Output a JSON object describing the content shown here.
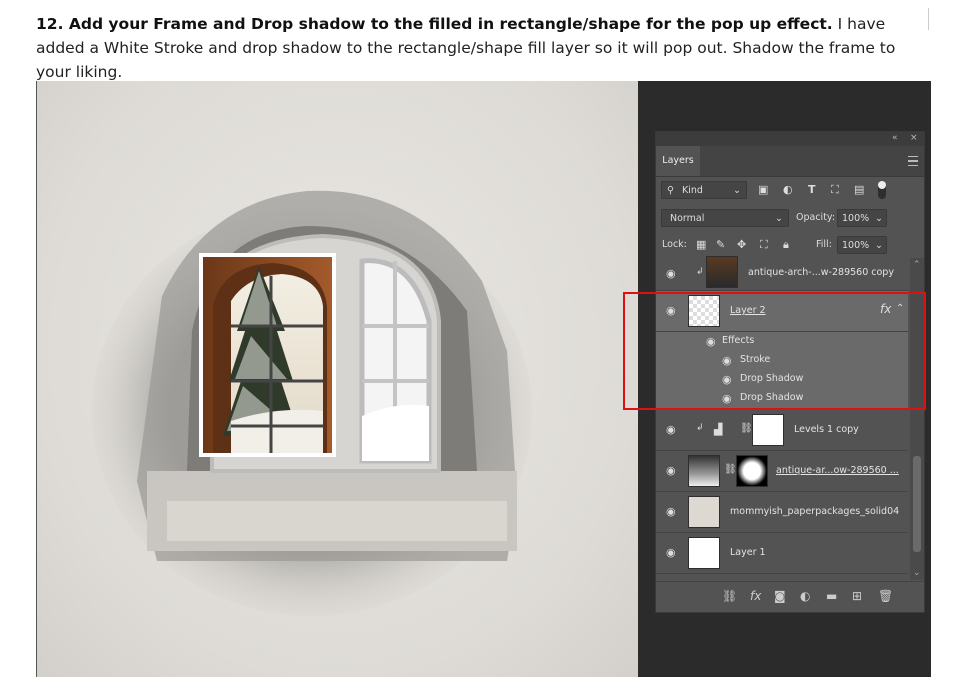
{
  "instructions": {
    "bold": "12. Add your Frame and Drop shadow to the filled in rectangle/shape for the pop up effect.",
    "rest": "I have added a White Stroke and drop shadow to the rectangle/shape fill layer so it will pop out. Shadow the frame to your liking."
  },
  "panel": {
    "tab": "Layers",
    "filter": "Kind",
    "blend_mode": "Normal",
    "opacity_label": "Opacity:",
    "opacity_value": "100%",
    "lock_label": "Lock:",
    "fill_label": "Fill:",
    "fill_value": "100%"
  },
  "layers": [
    {
      "name": "antique-arch-...w-289560 copy"
    },
    {
      "name": "Layer 2",
      "fx": "fx"
    },
    {
      "name": "Effects"
    },
    {
      "name": "Stroke"
    },
    {
      "name": "Drop Shadow"
    },
    {
      "name": "Drop Shadow"
    },
    {
      "name": "Levels 1 copy"
    },
    {
      "name": "antique-ar...ow-289560 ..."
    },
    {
      "name": "mommyish_paperpackages_solid04"
    },
    {
      "name": "Layer 1"
    }
  ],
  "icons": [
    "eye-icon",
    "link-icon",
    "fx-icon",
    "mask-icon",
    "adjustment-icon",
    "folder-icon",
    "new-layer-icon",
    "trash-icon"
  ],
  "colors": {
    "highlight": "#dd1111",
    "panel": "#535353"
  }
}
